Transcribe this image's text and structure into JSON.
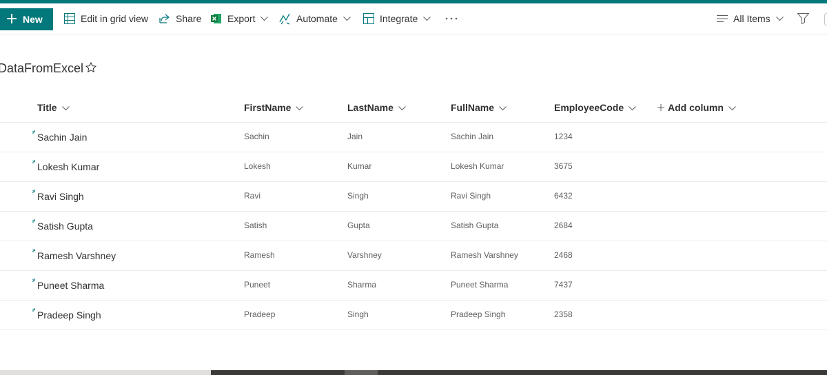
{
  "colors": {
    "accent": "#03787c",
    "text": "#323130",
    "muted": "#605e5c",
    "divider": "#edebe9"
  },
  "toolbar": {
    "new_label": "New",
    "grid_label": "Edit in grid view",
    "share_label": "Share",
    "export_label": "Export",
    "automate_label": "Automate",
    "integrate_label": "Integrate",
    "view_label": "All Items"
  },
  "icons": [
    "plus-icon",
    "grid-icon",
    "share-icon",
    "excel-icon",
    "automate-icon",
    "integrate-icon",
    "more-icon",
    "view-lines-icon",
    "filter-icon",
    "star-icon",
    "chevron-down-icon",
    "new-item-icon"
  ],
  "list": {
    "title": "DataFromExcel",
    "columns": [
      "Title",
      "FirstName",
      "LastName",
      "FullName",
      "EmployeeCode"
    ],
    "add_column_label": "Add column",
    "rows": [
      {
        "title": "Sachin Jain",
        "first": "Sachin",
        "last": "Jain",
        "full": "Sachin Jain",
        "code": "1234"
      },
      {
        "title": "Lokesh Kumar",
        "first": "Lokesh",
        "last": "Kumar",
        "full": "Lokesh Kumar",
        "code": "3675"
      },
      {
        "title": "Ravi Singh",
        "first": "Ravi",
        "last": "Singh",
        "full": "Ravi Singh",
        "code": "6432"
      },
      {
        "title": "Satish Gupta",
        "first": "Satish",
        "last": "Gupta",
        "full": "Satish Gupta",
        "code": "2684"
      },
      {
        "title": "Ramesh Varshney",
        "first": "Ramesh",
        "last": "Varshney",
        "full": "Ramesh Varshney",
        "code": "2468"
      },
      {
        "title": "Puneet Sharma",
        "first": "Puneet",
        "last": "Sharma",
        "full": "Puneet Sharma",
        "code": "7437"
      },
      {
        "title": "Pradeep Singh",
        "first": "Pradeep",
        "last": "Singh",
        "full": "Pradeep Singh",
        "code": "2358"
      }
    ]
  }
}
